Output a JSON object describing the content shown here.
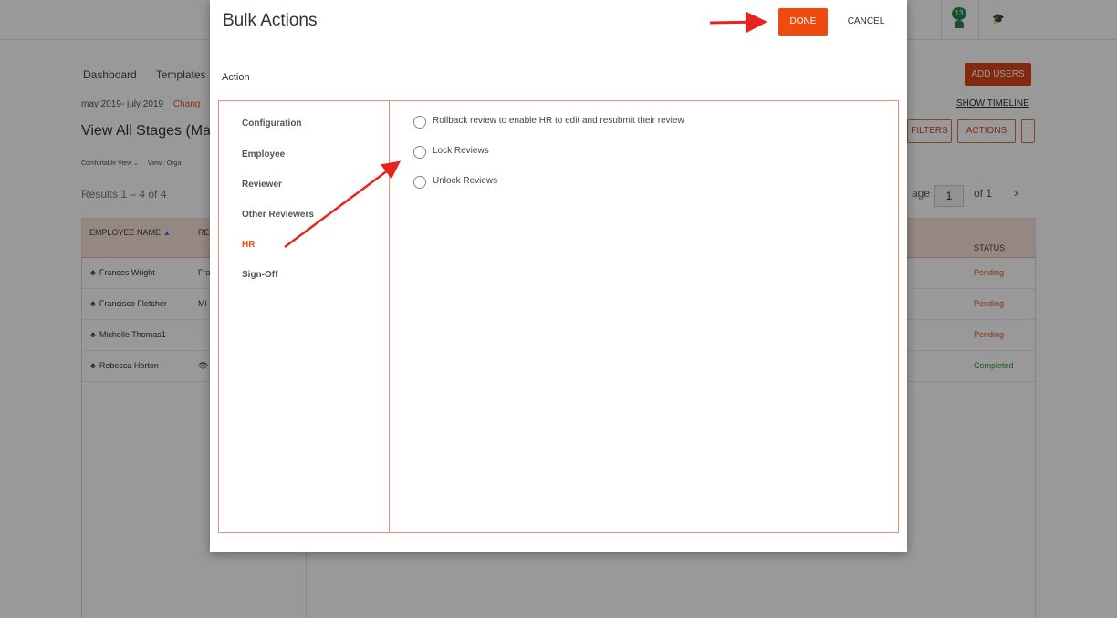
{
  "background": {
    "notification_count": "13",
    "nav": [
      "Dashboard",
      "Templates"
    ],
    "date_range": "may 2019- july 2019",
    "date_change": "Chang",
    "page_heading": "View All Stages (May",
    "view_pills": [
      "Comfortable View ⌄",
      "View : Orga"
    ],
    "results": "Results  1 – 4 of 4",
    "add_users": "ADD USERS",
    "show_timeline": "SHOW TIMELINE",
    "filters": "FILTERS",
    "actions": "ACTIONS",
    "more": "⋮",
    "pager_prefix": "age",
    "pager_value": "1",
    "pager_suffix": "of 1",
    "pager_next": "›",
    "columns": {
      "employee": "EMPLOYEE NAME",
      "reviewer": "RE",
      "status": "STATUS"
    },
    "rows": [
      {
        "name": "Frances Wright",
        "reviewer": "Fra",
        "status": "Pending",
        "status_color": "#e2572b"
      },
      {
        "name": "Francisco Fletcher",
        "reviewer": "Mi",
        "status": "Pending",
        "status_color": "#e2572b"
      },
      {
        "name": "Michelle Thomas1",
        "reviewer": "-",
        "status": "Pending",
        "status_color": "#e2572b"
      },
      {
        "name": "Rebecca Horton",
        "reviewer": "👁",
        "status": "Completed",
        "status_color": "#2e9a3a"
      }
    ]
  },
  "modal": {
    "title": "Bulk Actions",
    "done": "DONE",
    "cancel": "CANCEL",
    "action_label": "Action",
    "menu": [
      "Configuration",
      "Employee",
      "Reviewer",
      "Other Reviewers",
      "HR",
      "Sign-Off"
    ],
    "active_menu": "HR",
    "options": [
      "Rollback review to enable HR to edit and resubmit their review",
      "Lock Reviews",
      "Unlock Reviews"
    ]
  },
  "colors": {
    "accent": "#f04b0c",
    "annotation_arrow": "#e8231e"
  },
  "icons": {
    "notification": "bell-icon",
    "academy": "graduation-cap-icon",
    "org_chart": "org-chart-icon",
    "sort": "sort-ascending-icon"
  }
}
